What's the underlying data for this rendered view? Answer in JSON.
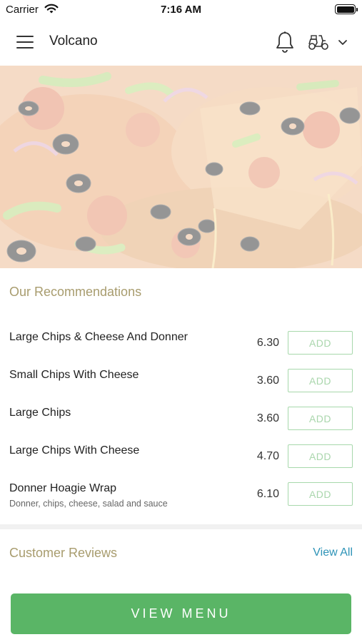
{
  "status_bar": {
    "carrier": "Carrier",
    "time": "7:16 AM",
    "wifi_icon": "wifi-icon",
    "battery_icon": "battery-icon"
  },
  "header": {
    "title": "Volcano",
    "menu_icon": "hamburger-menu-icon",
    "notification_icon": "bell-icon",
    "order_mode_icon": "delivery-scooter-icon",
    "dropdown_icon": "chevron-down-icon"
  },
  "hero": {
    "image": "pizza-photo"
  },
  "recommendations": {
    "title": "Our Recommendations",
    "items": [
      {
        "name": "Large Chips & Cheese And Donner",
        "description": "",
        "price": "6.30",
        "button": "ADD"
      },
      {
        "name": "Small Chips With Cheese",
        "description": "",
        "price": "3.60",
        "button": "ADD"
      },
      {
        "name": "Large Chips",
        "description": "",
        "price": "3.60",
        "button": "ADD"
      },
      {
        "name": "Large Chips With Cheese",
        "description": "",
        "price": "4.70",
        "button": "ADD"
      },
      {
        "name": "Donner Hoagie Wrap",
        "description": "Donner, chips, cheese, salad and sauce",
        "price": "6.10",
        "button": "ADD"
      }
    ]
  },
  "reviews": {
    "title": "Customer Reviews",
    "view_all": "View All"
  },
  "cta": {
    "view_menu": "VIEW MENU"
  },
  "colors": {
    "accent_green": "#5ab566",
    "add_button_border": "#a7d8ab",
    "section_title": "#a89c6e",
    "link_blue": "#2d93b7"
  }
}
